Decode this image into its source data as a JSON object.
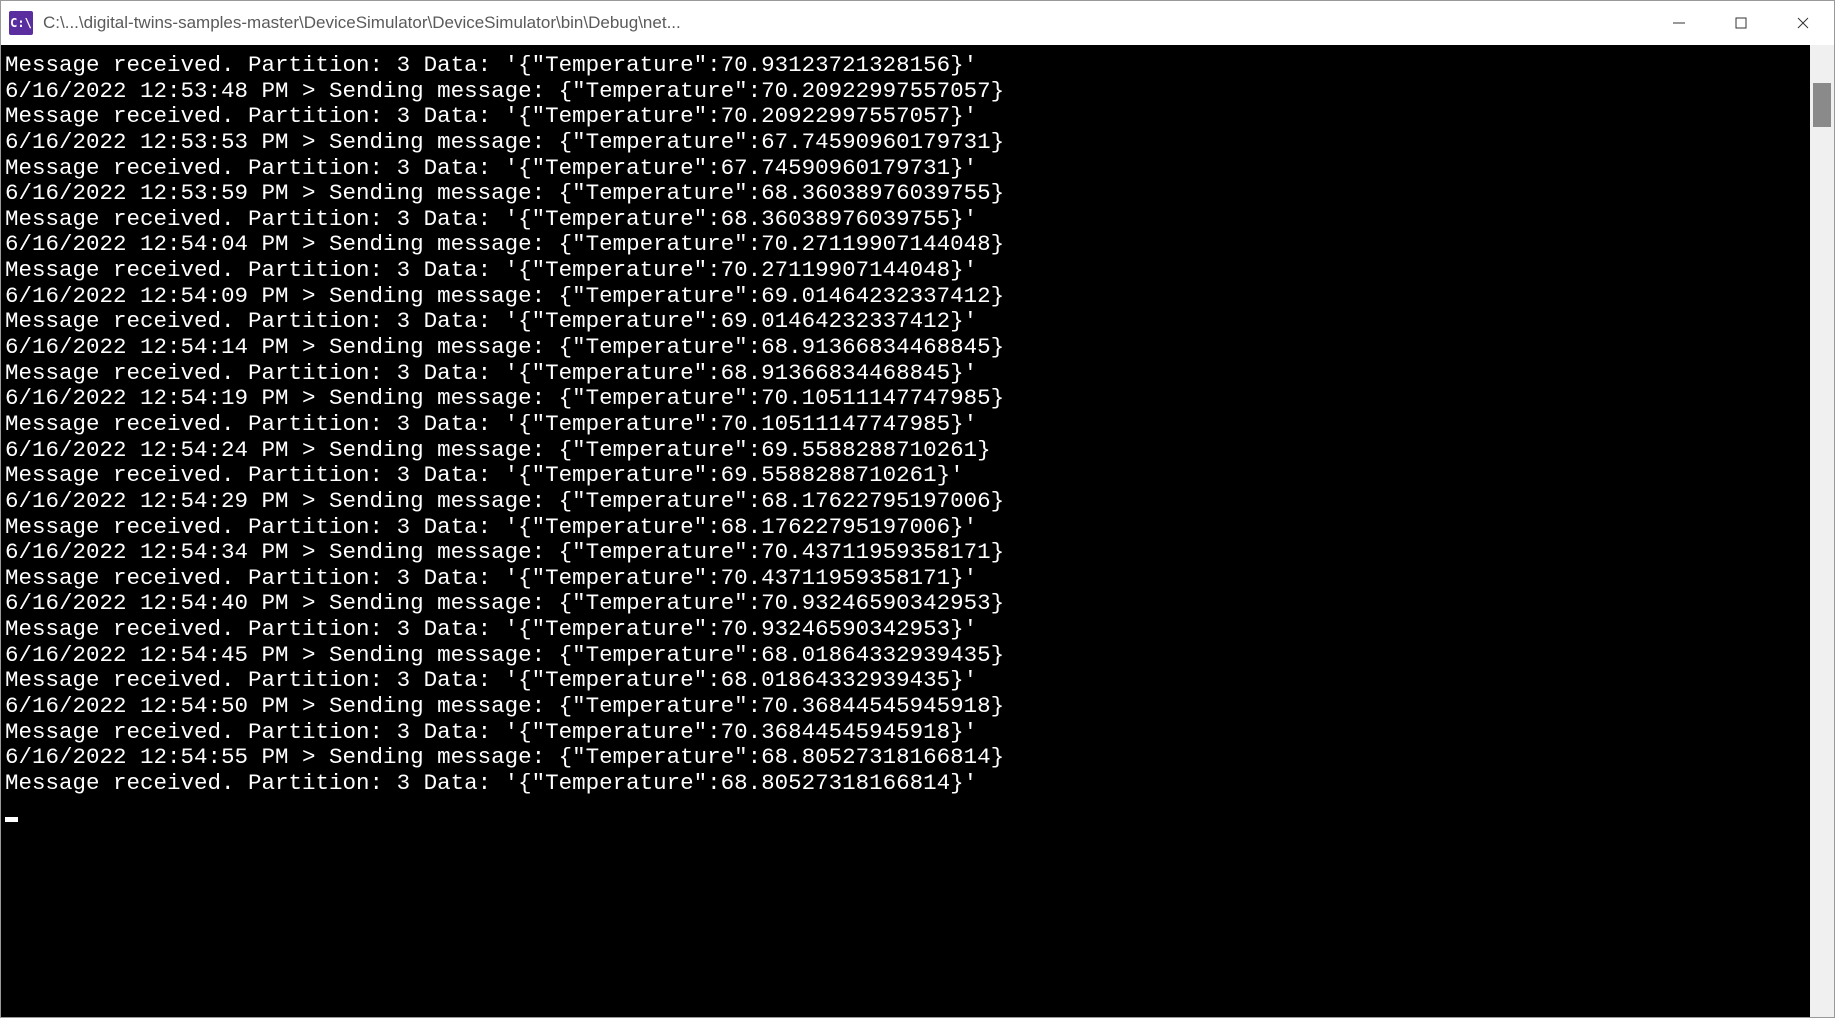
{
  "window": {
    "icon_label": "C:\\",
    "title": "C:\\...\\digital-twins-samples-master\\DeviceSimulator\\DeviceSimulator\\bin\\Debug\\net..."
  },
  "console": {
    "partition": 3,
    "received_prefix": "Message received. Partition: ",
    "data_prefix": " Data: '{\"Temperature\":",
    "data_suffix": "}'",
    "send_prefix": " > Sending message: {\"Temperature\":",
    "send_suffix": "}",
    "initial_received": 70.93123721328156,
    "events": [
      {
        "ts": "6/16/2022 12:53:48 PM",
        "temp": 70.20922997557057
      },
      {
        "ts": "6/16/2022 12:53:53 PM",
        "temp": 67.74590960179731
      },
      {
        "ts": "6/16/2022 12:53:59 PM",
        "temp": 68.36038976039755
      },
      {
        "ts": "6/16/2022 12:54:04 PM",
        "temp": 70.27119907144048
      },
      {
        "ts": "6/16/2022 12:54:09 PM",
        "temp": 69.01464232337412
      },
      {
        "ts": "6/16/2022 12:54:14 PM",
        "temp": 68.91366834468845
      },
      {
        "ts": "6/16/2022 12:54:19 PM",
        "temp": 70.10511147747985
      },
      {
        "ts": "6/16/2022 12:54:24 PM",
        "temp": 69.5588288710261
      },
      {
        "ts": "6/16/2022 12:54:29 PM",
        "temp": 68.17622795197006
      },
      {
        "ts": "6/16/2022 12:54:34 PM",
        "temp": 70.43711959358171
      },
      {
        "ts": "6/16/2022 12:54:40 PM",
        "temp": 70.93246590342953
      },
      {
        "ts": "6/16/2022 12:54:45 PM",
        "temp": 68.01864332939435
      },
      {
        "ts": "6/16/2022 12:54:50 PM",
        "temp": 70.36844545945918
      },
      {
        "ts": "6/16/2022 12:54:55 PM",
        "temp": 68.80527318166814
      }
    ]
  }
}
